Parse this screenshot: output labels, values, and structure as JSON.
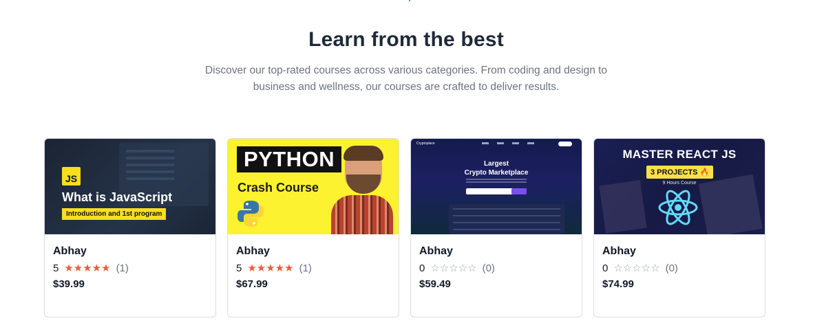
{
  "section": {
    "title": "Learn from the best",
    "description": "Discover our top-rated courses across various categories. From coding and design to business and wellness, our courses are crafted to deliver results."
  },
  "colors": {
    "star_filled": "#ef5a3c",
    "star_empty": "#9ca3af",
    "heading": "#1f2937",
    "muted": "#6b7280"
  },
  "courses": [
    {
      "thumbnail": {
        "badge": "JS",
        "title": "What is JavaScript",
        "subtitle": "Introduction and 1st program"
      },
      "author": "Abhay",
      "rating": "5",
      "stars": "★★★★★",
      "review_count": "(1)",
      "price": "$39.99"
    },
    {
      "thumbnail": {
        "title": "PYTHON",
        "subtitle": "Crash Course"
      },
      "author": "Abhay",
      "rating": "5",
      "stars": "★★★★★",
      "review_count": "(1)",
      "price": "$67.99"
    },
    {
      "thumbnail": {
        "brand": "Cryptoplace",
        "title_line1": "Largest",
        "title_line2": "Crypto Marketplace"
      },
      "author": "Abhay",
      "rating": "0",
      "stars": "☆☆☆☆☆",
      "review_count": "(0)",
      "price": "$59.49"
    },
    {
      "thumbnail": {
        "title": "MASTER REACT JS",
        "badge": "3 PROJECTS 🔥",
        "subtitle": "9 Hours Course"
      },
      "author": "Abhay",
      "rating": "0",
      "stars": "☆☆☆☆☆",
      "review_count": "(0)",
      "price": "$74.99"
    }
  ]
}
